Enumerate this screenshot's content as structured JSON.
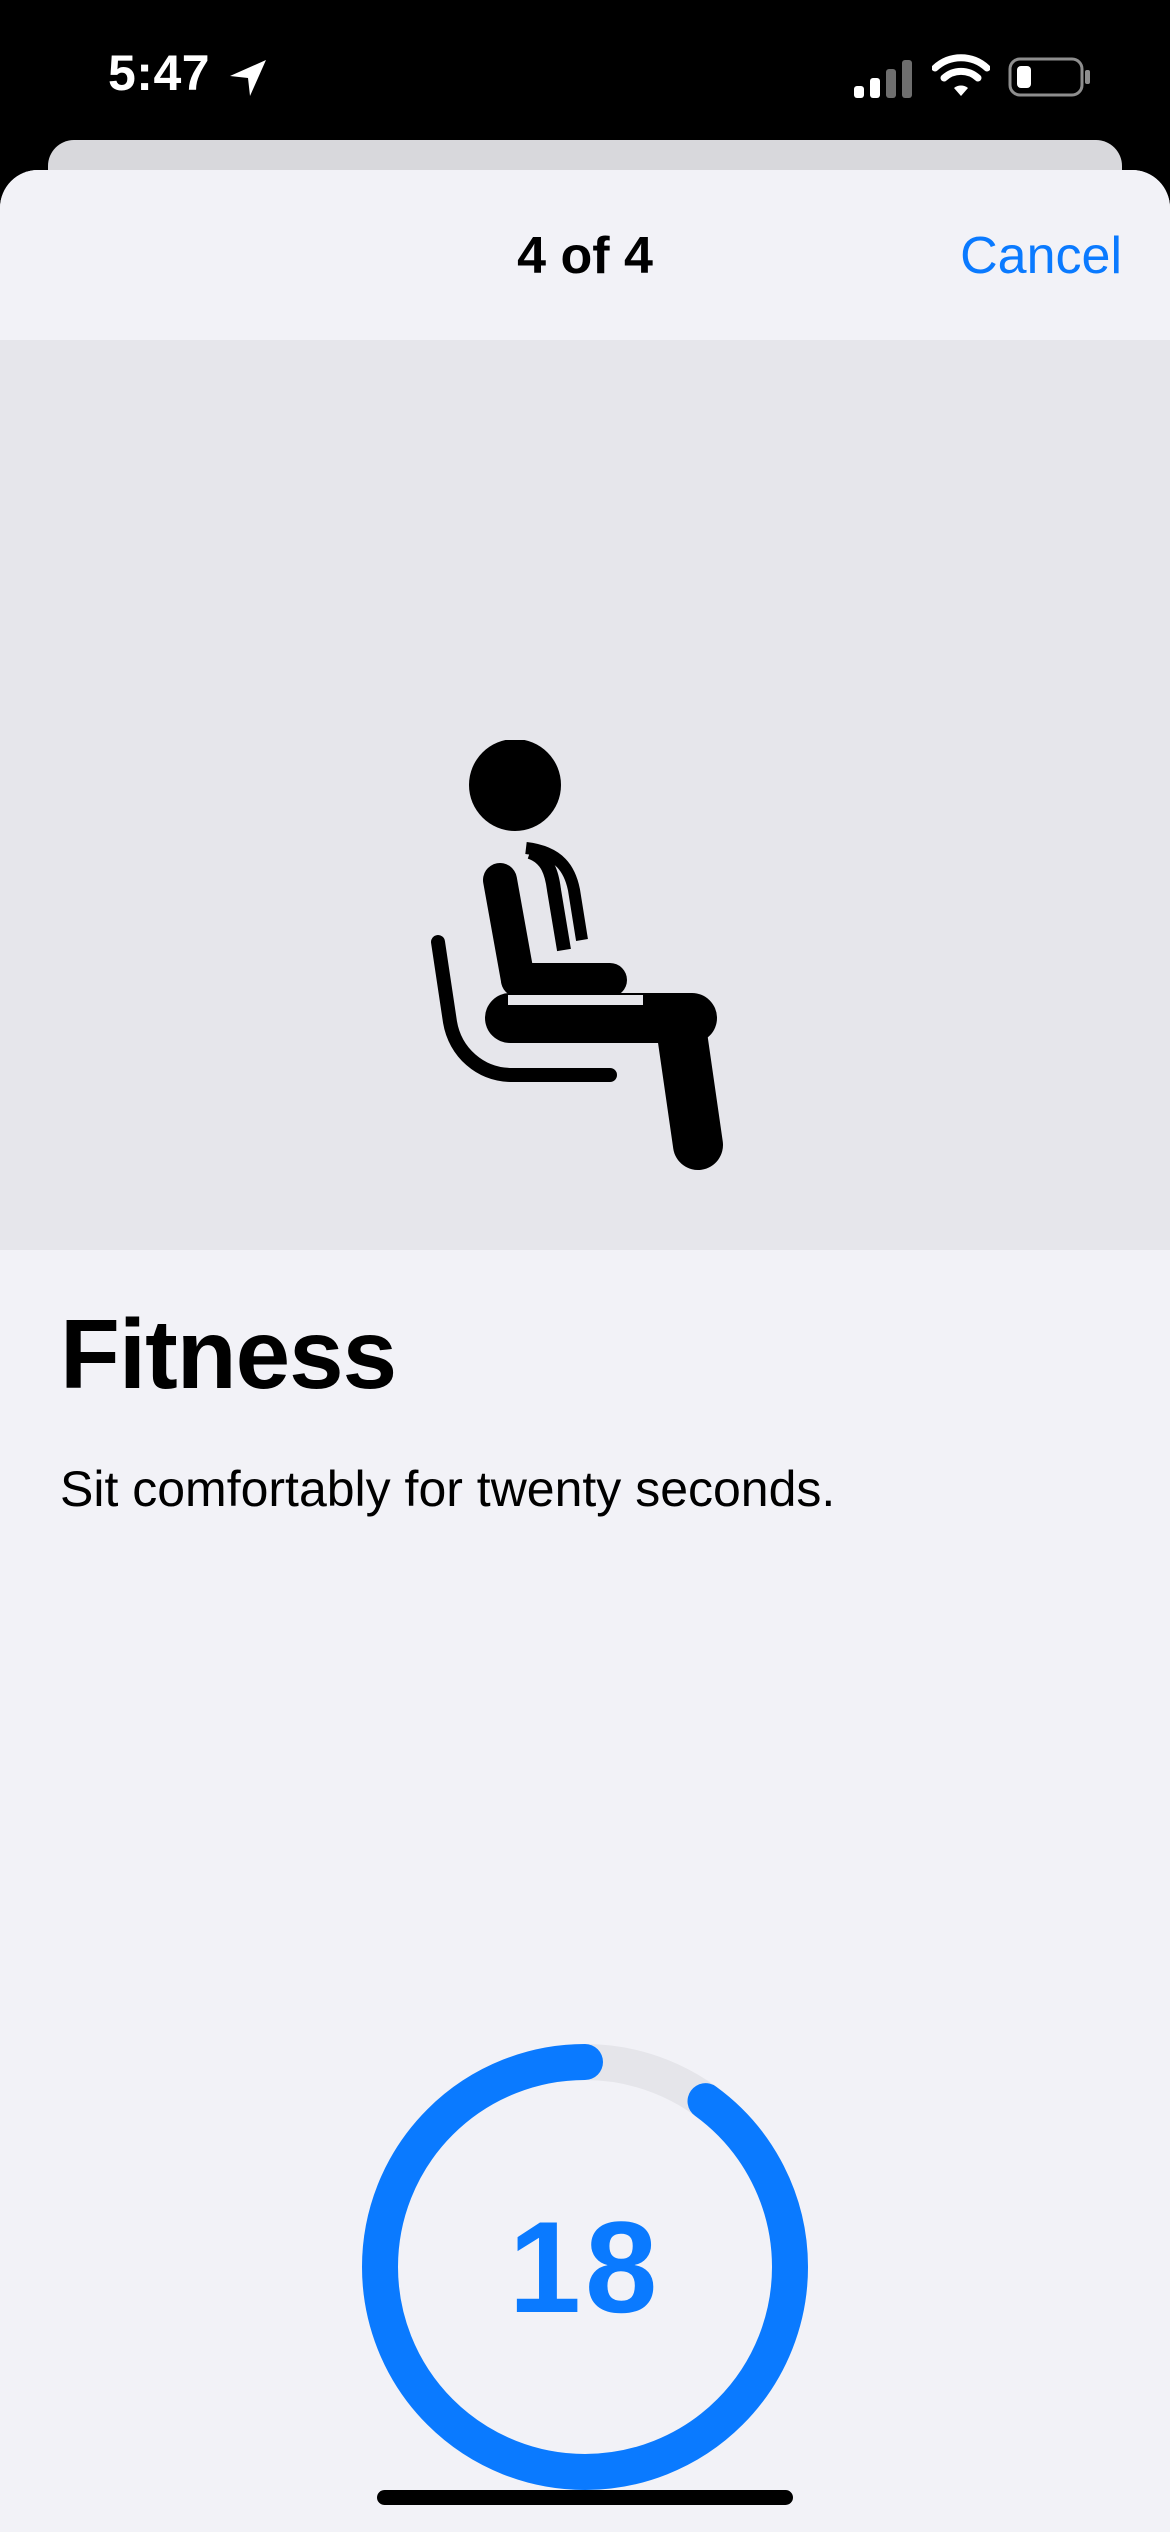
{
  "status_bar": {
    "time": "5:47"
  },
  "nav": {
    "title": "4 of 4",
    "cancel_label": "Cancel"
  },
  "content": {
    "heading": "Fitness",
    "instruction": "Sit comfortably for twenty seconds."
  },
  "timer": {
    "value": "18",
    "progress_fraction": 0.9
  },
  "colors": {
    "accent": "#0a7aff",
    "sheet_background": "#f2f2f7",
    "hero_background": "#e6e6eb",
    "ring_track": "#e5e5ea"
  },
  "icons": {
    "hero": "person-sitting-icon",
    "status": [
      "location-arrow-icon",
      "cellular-signal-icon",
      "wifi-icon",
      "battery-icon"
    ]
  }
}
